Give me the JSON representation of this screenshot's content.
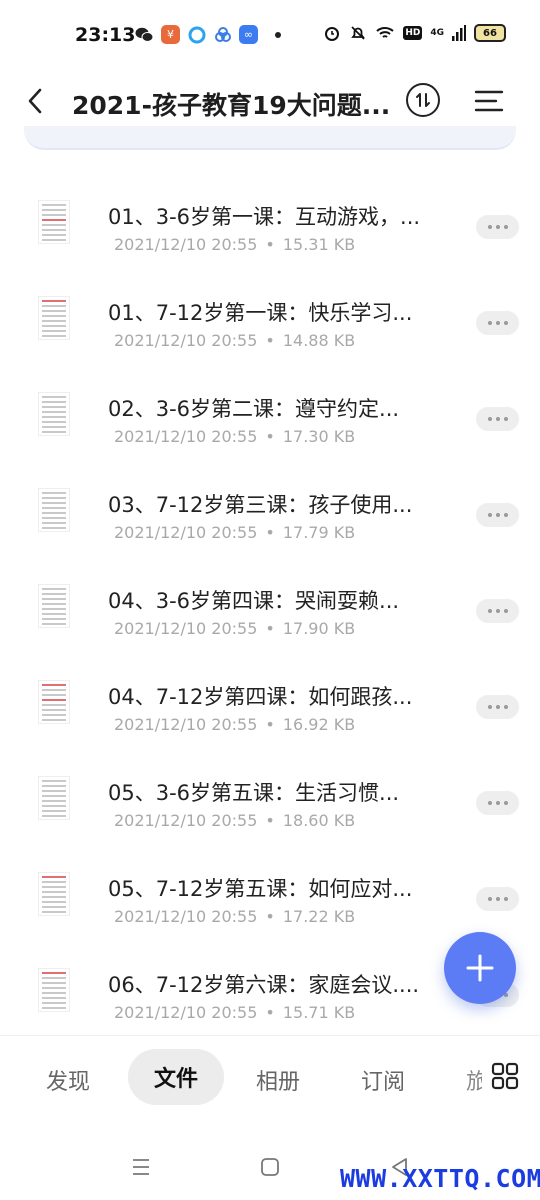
{
  "status_bar": {
    "time": "23:13",
    "network": "4G",
    "battery": "66",
    "hd_badge": "HD",
    "icons": [
      "wechat-icon",
      "app-icon",
      "browser-icon",
      "cloud-icon",
      "baidu-cloud-icon",
      "alarm-icon",
      "mute-bell-icon",
      "wifi-icon",
      "signal-icon"
    ]
  },
  "header": {
    "title": "2021-孩子教育19大问题...",
    "back_icon": "chevron-left-icon",
    "sort_icon": "sort-icon",
    "menu_icon": "menu-icon"
  },
  "files": [
    {
      "name": "01、3-6岁第一课：互动游戏，...",
      "date": "2021/12/10 20:55",
      "size": "15.31 KB"
    },
    {
      "name": "01、7-12岁第一课：快乐学习...",
      "date": "2021/12/10 20:55",
      "size": "14.88 KB"
    },
    {
      "name": "02、3-6岁第二课：遵守约定...",
      "date": "2021/12/10 20:55",
      "size": "17.30 KB"
    },
    {
      "name": "03、7-12岁第三课：孩子使用...",
      "date": "2021/12/10 20:55",
      "size": "17.79 KB"
    },
    {
      "name": "04、3-6岁第四课：哭闹耍赖...",
      "date": "2021/12/10 20:55",
      "size": "17.90 KB"
    },
    {
      "name": "04、7-12岁第四课：如何跟孩...",
      "date": "2021/12/10 20:55",
      "size": "16.92 KB"
    },
    {
      "name": "05、3-6岁第五课：生活习惯...",
      "date": "2021/12/10 20:55",
      "size": "18.60 KB"
    },
    {
      "name": "05、7-12岁第五课：如何应对...",
      "date": "2021/12/10 20:55",
      "size": "17.22 KB"
    },
    {
      "name": "06、7-12岁第六课：家庭会议....",
      "date": "2021/12/10 20:55",
      "size": "15.71 KB"
    }
  ],
  "meta_separator": "•",
  "fab": {
    "icon": "plus-icon"
  },
  "bottom_nav": {
    "discover": "发现",
    "files": "文件",
    "album": "相册",
    "subscribe": "订阅",
    "partial": "旅",
    "grid_icon": "grid-icon"
  },
  "system_nav": {
    "icons": [
      "recent-apps-icon",
      "home-icon",
      "back-icon"
    ]
  },
  "watermark": "WWW.XXTTQ.COM",
  "colors": {
    "accent": "#5b7cf4",
    "meta_text": "#a9a9a9",
    "watermark": "#1a3ce0"
  }
}
